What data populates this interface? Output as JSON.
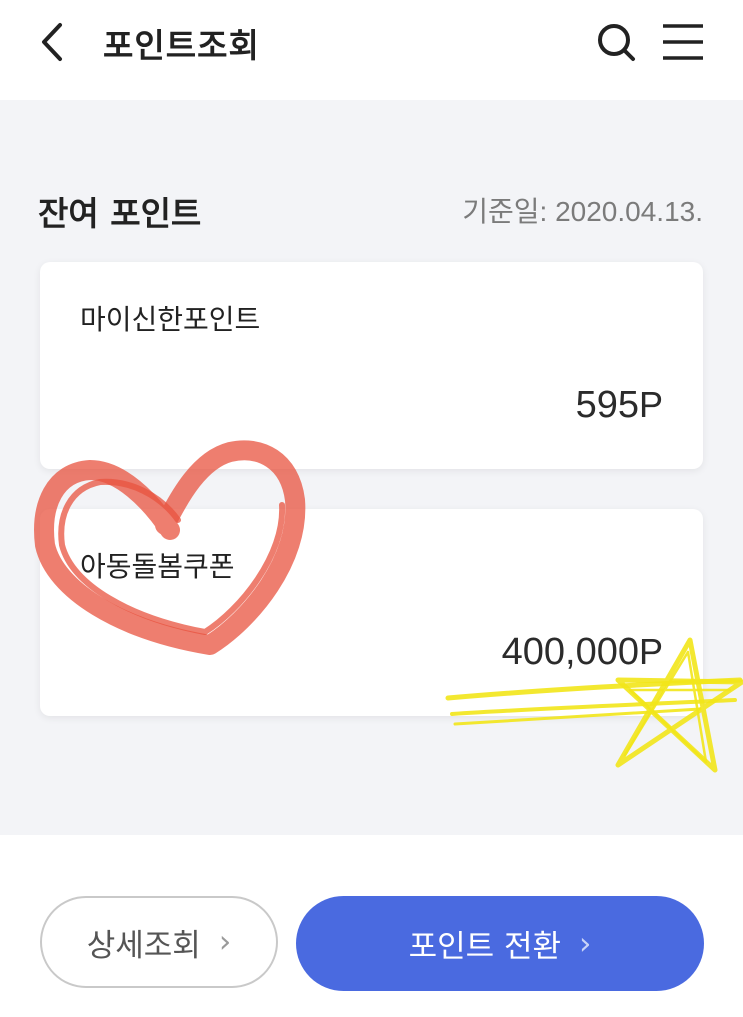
{
  "header": {
    "title": "포인트조회",
    "back_icon": "chevron-left-icon",
    "search_icon": "search-icon",
    "menu_icon": "hamburger-menu-icon"
  },
  "balance": {
    "section_title": "잔여 포인트",
    "base_date": "기준일: 2020.04.13."
  },
  "cards": [
    {
      "name": "마이신한포인트",
      "value": "595",
      "unit": "P"
    },
    {
      "name": "아동돌봄쿠폰",
      "value": "400,000",
      "unit": "P"
    }
  ],
  "actions": {
    "detail_label": "상세조회",
    "convert_label": "포인트 전환",
    "chevron": "›"
  },
  "colors": {
    "accent": "#4a6ae0",
    "background_gray": "#f3f4f7",
    "heart_doodle": "#e8533f",
    "star_doodle": "#f2e51a"
  }
}
